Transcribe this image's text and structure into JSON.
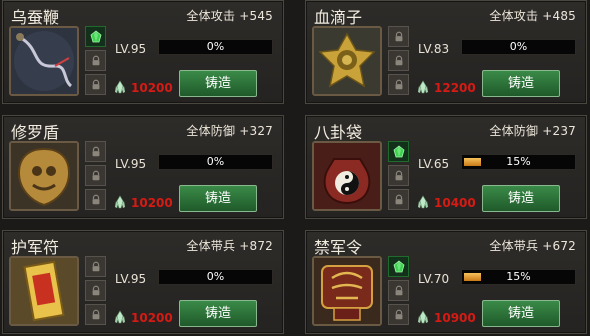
{
  "items": [
    {
      "name": "乌蚕鞭",
      "stat_label": "全体攻击",
      "stat_value": "+545",
      "level": "LV.95",
      "progress_text": "0%",
      "progress": 0,
      "cost": "10200",
      "button": "铸造",
      "slot_icons": [
        "green-gem-icon",
        "lock-icon",
        "lock-icon"
      ]
    },
    {
      "name": "血滴子",
      "stat_label": "全体攻击",
      "stat_value": "+485",
      "level": "LV.83",
      "progress_text": "0%",
      "progress": 0,
      "cost": "12200",
      "button": "铸造",
      "slot_icons": [
        "lock-icon",
        "lock-icon",
        "lock-icon"
      ]
    },
    {
      "name": "修罗盾",
      "stat_label": "全体防御",
      "stat_value": "+327",
      "level": "LV.95",
      "progress_text": "0%",
      "progress": 0,
      "cost": "10200",
      "button": "铸造",
      "slot_icons": [
        "lock-icon",
        "lock-icon",
        "lock-icon"
      ]
    },
    {
      "name": "八卦袋",
      "stat_label": "全体防御",
      "stat_value": "+237",
      "level": "LV.65",
      "progress_text": "15%",
      "progress": 0.15,
      "cost": "10400",
      "button": "铸造",
      "slot_icons": [
        "green-gem-icon",
        "lock-icon",
        "lock-icon"
      ]
    },
    {
      "name": "护军符",
      "stat_label": "全体带兵",
      "stat_value": "+872",
      "level": "LV.95",
      "progress_text": "0%",
      "progress": 0,
      "cost": "10200",
      "button": "铸造",
      "slot_icons": [
        "lock-icon",
        "lock-icon",
        "lock-icon"
      ]
    },
    {
      "name": "禁军令",
      "stat_label": "全体带兵",
      "stat_value": "+672",
      "level": "LV.70",
      "progress_text": "15%",
      "progress": 0.15,
      "cost": "10900",
      "button": "铸造",
      "slot_icons": [
        "green-gem-icon",
        "lock-icon",
        "lock-icon"
      ]
    }
  ],
  "colors": {
    "cost": "#d61a14",
    "button": "#2f7a3c",
    "progress_fill": "#e8a030"
  }
}
